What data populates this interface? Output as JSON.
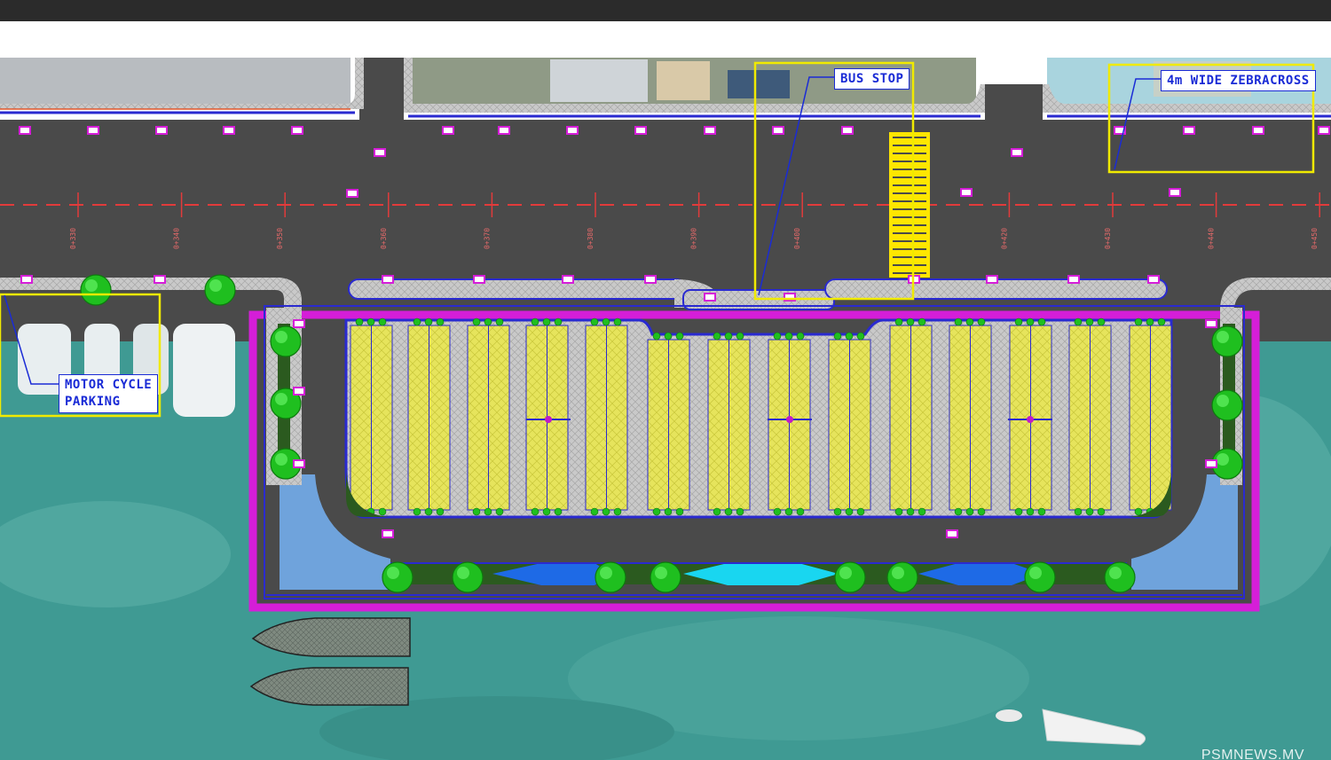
{
  "labels": {
    "bus_stop": "BUS STOP",
    "zebra_cross": "4m WIDE ZEBRACROSS",
    "motorcycle_line1": "MOTOR CYCLE",
    "motorcycle_line2": "PARKING"
  },
  "chainages": [
    "0+330",
    "0+340",
    "0+350",
    "0+360",
    "0+370",
    "0+380",
    "0+390",
    "0+400",
    "0+410",
    "0+420",
    "0+430",
    "0+440",
    "0+450"
  ],
  "watermark": "PSMNEWS.MV",
  "colors": {
    "road": "#4a4a4a",
    "water": "#3f9a93",
    "parking_stall": "#e6e45c",
    "quay_edge": "#d51ed8",
    "annotation": "#1a2bd6",
    "callout_box": "#f0ea00",
    "zebra": "#ffe600",
    "tree": "#1fbf1f"
  }
}
